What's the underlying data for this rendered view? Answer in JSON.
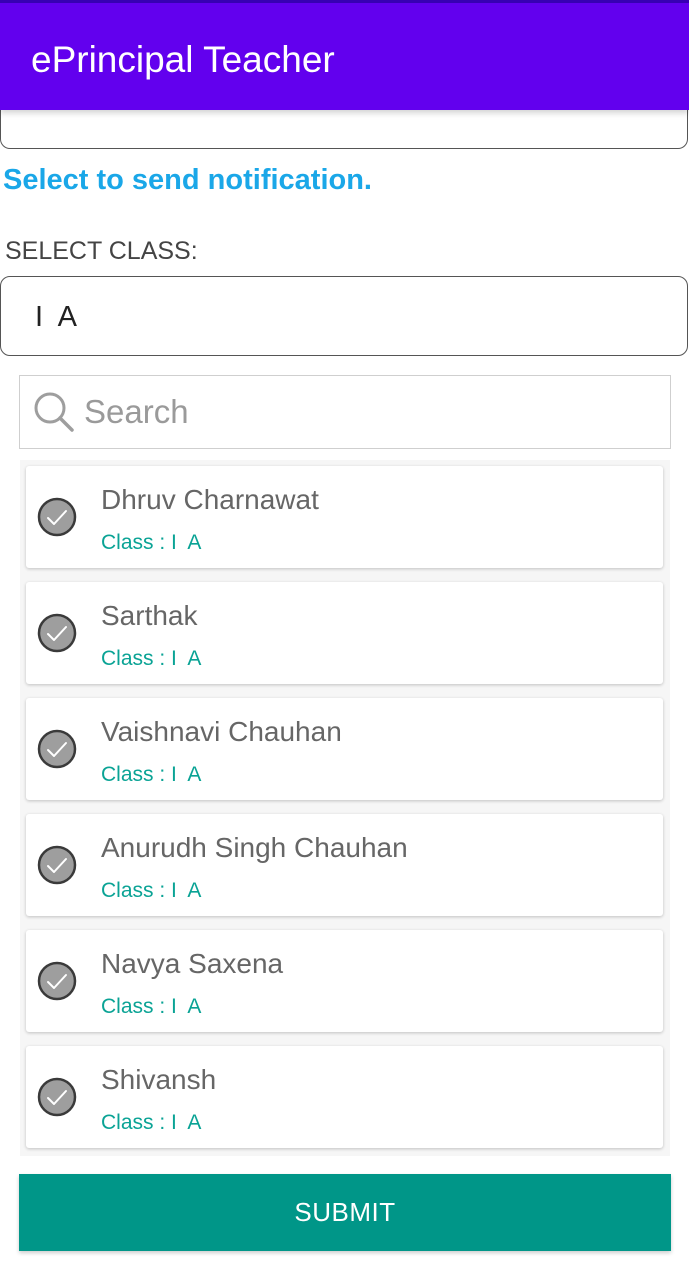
{
  "app_bar": {
    "title": "ePrincipal Teacher",
    "color": "#6200ee"
  },
  "notify_heading": "Select to send notification.",
  "select_class": {
    "label": "SELECT CLASS:",
    "value": "I  A"
  },
  "search": {
    "placeholder": "Search",
    "value": "",
    "icon": "search-icon"
  },
  "students": [
    {
      "name": "Dhruv Charnawat",
      "class_text": "Class : I  A",
      "checked": true
    },
    {
      "name": "Sarthak",
      "class_text": "Class : I  A",
      "checked": true
    },
    {
      "name": "Vaishnavi Chauhan",
      "class_text": "Class : I  A",
      "checked": true
    },
    {
      "name": "Anurudh Singh Chauhan",
      "class_text": "Class : I  A",
      "checked": true
    },
    {
      "name": "Navya Saxena",
      "class_text": "Class : I  A",
      "checked": true
    },
    {
      "name": "Shivansh",
      "class_text": "Class : I  A",
      "checked": true
    }
  ],
  "submit": {
    "label": "SUBMIT",
    "color": "#009688"
  },
  "colors": {
    "accent_heading": "#1aa7e8",
    "class_text": "#0aa395"
  }
}
